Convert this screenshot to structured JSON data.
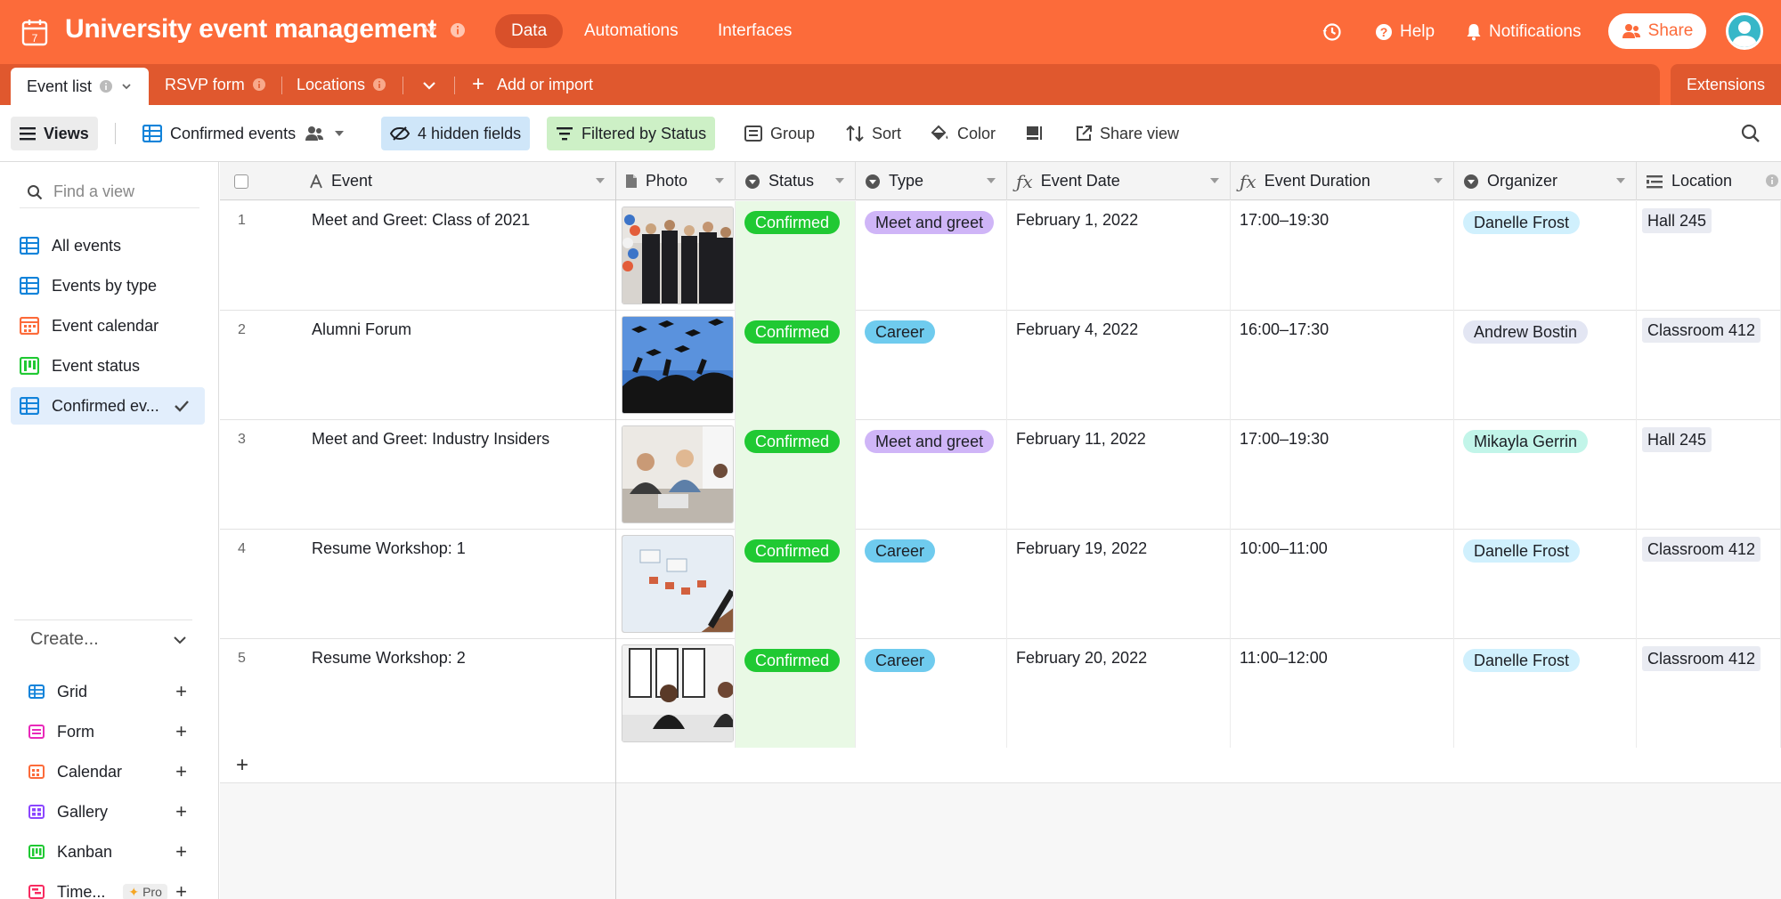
{
  "app": {
    "title": "University event management",
    "nav": [
      {
        "label": "Data",
        "active": true
      },
      {
        "label": "Automations",
        "active": false
      },
      {
        "label": "Interfaces",
        "active": false
      }
    ],
    "help_label": "Help",
    "notifications_label": "Notifications",
    "share_label": "Share",
    "accent_color": "#fc6b3a"
  },
  "tables": {
    "items": [
      {
        "label": "Event list",
        "active": true
      },
      {
        "label": "RSVP form",
        "active": false
      },
      {
        "label": "Locations",
        "active": false
      }
    ],
    "add_label": "Add or import",
    "extensions_label": "Extensions"
  },
  "toolbar": {
    "views_label": "Views",
    "current_view": "Confirmed events",
    "hidden_fields": "4 hidden fields",
    "filter": "Filtered by Status",
    "group": "Group",
    "sort": "Sort",
    "color": "Color",
    "share_view": "Share view"
  },
  "sidebar": {
    "find_placeholder": "Find a view",
    "views": [
      {
        "label": "All events",
        "icon": "grid-icon",
        "color": "#1283da"
      },
      {
        "label": "Events by type",
        "icon": "grid-icon",
        "color": "#1283da"
      },
      {
        "label": "Event calendar",
        "icon": "calendar-icon",
        "color": "#f82b60"
      },
      {
        "label": "Event status",
        "icon": "kanban-icon",
        "color": "#20c933"
      },
      {
        "label": "Confirmed ev...",
        "icon": "grid-icon",
        "color": "#1283da",
        "active": true
      }
    ],
    "create_label": "Create...",
    "create_items": [
      {
        "label": "Grid",
        "color": "#1283da"
      },
      {
        "label": "Form",
        "color": "#e929ba"
      },
      {
        "label": "Calendar",
        "color": "#fc6b3a"
      },
      {
        "label": "Gallery",
        "color": "#8b46ff"
      },
      {
        "label": "Kanban",
        "color": "#20c933"
      },
      {
        "label": "Time...",
        "color": "#f82b60",
        "badge": "Pro"
      }
    ]
  },
  "grid": {
    "columns": [
      "Event",
      "Photo",
      "Status",
      "Type",
      "Event Date",
      "Event Duration",
      "Organizer",
      "Location"
    ],
    "rows": [
      {
        "num": "1",
        "event": "Meet and Greet: Class of 2021",
        "status": "Confirmed",
        "type": "Meet and greet",
        "date": "February 1, 2022",
        "duration": "17:00–19:30",
        "organizer": "Danelle Frost",
        "location": "Hall 245"
      },
      {
        "num": "2",
        "event": "Alumni Forum",
        "status": "Confirmed",
        "type": "Career",
        "date": "February 4, 2022",
        "duration": "16:00–17:30",
        "organizer": "Andrew Bostin",
        "location": "Classroom 412"
      },
      {
        "num": "3",
        "event": "Meet and Greet: Industry Insiders",
        "status": "Confirmed",
        "type": "Meet and greet",
        "date": "February 11, 2022",
        "duration": "17:00–19:30",
        "organizer": "Mikayla Gerrin",
        "location": "Hall 245"
      },
      {
        "num": "4",
        "event": "Resume Workshop: 1",
        "status": "Confirmed",
        "type": "Career",
        "date": "February 19, 2022",
        "duration": "10:00–11:00",
        "organizer": "Danelle Frost",
        "location": "Classroom 412"
      },
      {
        "num": "5",
        "event": "Resume Workshop: 2",
        "status": "Confirmed",
        "type": "Career",
        "date": "February 20, 2022",
        "duration": "11:00–12:00",
        "organizer": "Danelle Frost",
        "location": "Classroom 412"
      }
    ]
  }
}
